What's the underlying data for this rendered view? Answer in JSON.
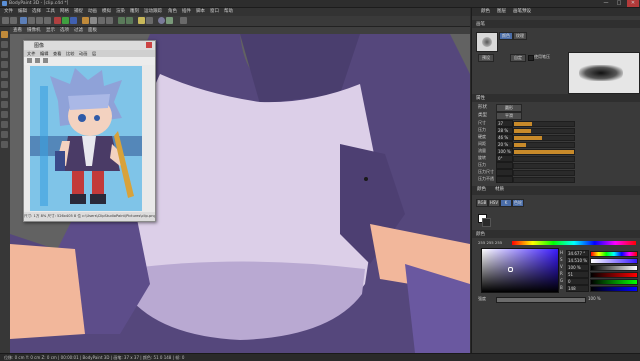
{
  "window": {
    "title": "BodyPaint 3D - [clip.c4d *]",
    "min": "—",
    "max": "□",
    "close": "✕"
  },
  "menubar": [
    "文件",
    "编辑",
    "选择",
    "工具",
    "网格",
    "捕捉",
    "动画",
    "模拟",
    "渲染",
    "雕刻",
    "运动跟踪",
    "角色",
    "插件",
    "脚本",
    "窗口",
    "帮助"
  ],
  "viewport": {
    "menu": [
      "查看",
      "摄像机",
      "显示",
      "选项",
      "过滤",
      "面板"
    ],
    "corner_label": "透视视图"
  },
  "image_viewer": {
    "title": "图像",
    "menu": [
      "文件",
      "编辑",
      "查看",
      "比较",
      "动画",
      "层"
    ],
    "status": "尺寸: 1万 8% 尺寸: 526x405 8 位 c:\\Users\\ClipStudioPaint\\Pictures\\clip.png"
  },
  "right_panel": {
    "top_tabs": [
      "颜色",
      "图层",
      "画笔预设"
    ],
    "section_brush": "画笔",
    "brush_tabs": [
      "颜色",
      "纹理",
      "设置"
    ],
    "brush_mode_label": "形状",
    "preset_btn": "预设",
    "custom_btn": "自定",
    "checkbox_label": "使用笔压",
    "section_props": "属性",
    "shape_label": "形状",
    "shape_value": "圆形",
    "type_label": "类型",
    "type_value": "平滑",
    "rows": [
      {
        "label": "尺寸",
        "value": "37",
        "pct": 0.3
      },
      {
        "label": "压力",
        "value": "28 %",
        "pct": 0.28
      },
      {
        "label": "硬度",
        "value": "46 %",
        "pct": 0.46
      },
      {
        "label": "间距",
        "value": "20 %",
        "pct": 0.2
      },
      {
        "label": "流量",
        "value": "100 %",
        "pct": 1.0
      },
      {
        "label": "旋转",
        "value": "0°",
        "pct": 0.0
      },
      {
        "label": "压力",
        "value": "",
        "pct": 0.0
      },
      {
        "label": "压力尺寸",
        "value": "",
        "pct": 0.0
      },
      {
        "label": "压力不透",
        "value": "",
        "pct": 0.0
      }
    ],
    "color_tabs": [
      "颜色",
      "材质"
    ],
    "color_subtabs": [
      "RGB",
      "HSV",
      "K",
      "色轮"
    ],
    "color_picker_label": "颜色",
    "color_hex_label": "255 255 255",
    "channels": [
      {
        "label": "H",
        "value": "34.677 °"
      },
      {
        "label": "S",
        "value": "14.510 %"
      },
      {
        "label": "V",
        "value": "100 %"
      },
      {
        "label": "R",
        "value": "51"
      },
      {
        "label": "G",
        "value": "0"
      },
      {
        "label": "B",
        "value": "148"
      }
    ],
    "opacity_label": "强度",
    "opacity_value": "100 %"
  },
  "statusbar": {
    "text": "位移: 0 cm  Y: 0 cm  Z: 0 cm  |  00:00:01  |  BodyPaint 3D  |  画笔: 37 x 37  |  颜色: 51 0 148  |  帧: 0"
  },
  "colors": {
    "ui_dark": "#2b2b2b",
    "accent": "#4a6da8",
    "shirt": "#d8cbe6",
    "jacket": "#57497e",
    "skin": "#f2b79b"
  }
}
